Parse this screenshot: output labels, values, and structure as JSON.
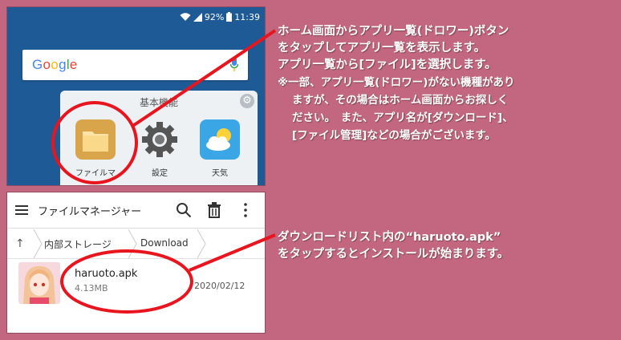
{
  "top_screen": {
    "status": {
      "battery": "92%",
      "time": "11:39"
    },
    "search_brand": "Google",
    "folder_title": "基本機能",
    "apps": [
      {
        "label": "ファイルマ"
      },
      {
        "label": "設定"
      },
      {
        "label": "天気"
      }
    ]
  },
  "file_manager": {
    "title": "ファイルマネージャー",
    "breadcrumb": [
      "内部ストレージ",
      "Download"
    ],
    "file": {
      "name": "haruoto.apk",
      "size": "4.13MB",
      "date": "2020/02/12"
    }
  },
  "instructions": {
    "step1": [
      "ホーム画面からアプリ一覧(ドロワー)ボタン",
      "をタップしてアプリ一覧を表示します。",
      "アプリ一覧から[ファイル]を選択します。"
    ],
    "note": [
      "※一部、アプリ一覧(ドロワー)がない機種があり",
      "ますが、その場合はホーム画面からお探しく",
      "ださい。　また、アプリ名が[ダウンロード]、",
      "[ファイル管理]などの場合がございます。"
    ],
    "step2": [
      "ダウンロードリスト内の“haruoto.apk”",
      "をタップするとインストールが始まります。"
    ]
  },
  "colors": {
    "background": "#c2677f",
    "home_wallpaper": "#1e5a96",
    "highlight": "#e8141e"
  }
}
